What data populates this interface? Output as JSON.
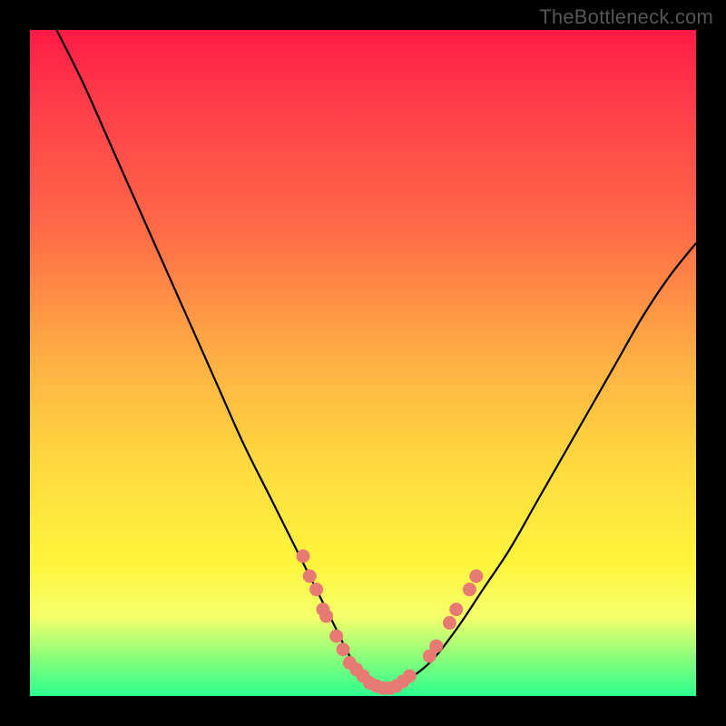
{
  "watermark": "TheBottleneck.com",
  "chart_data": {
    "type": "line",
    "title": "",
    "xlabel": "",
    "ylabel": "",
    "xlim": [
      0,
      100
    ],
    "ylim": [
      0,
      100
    ],
    "grid": false,
    "legend": false,
    "series": [
      {
        "name": "curve",
        "style": "black-line",
        "x": [
          4,
          8,
          12,
          16,
          20,
          24,
          28,
          32,
          36,
          40,
          44,
          46,
          48,
          50,
          52,
          54,
          56,
          60,
          64,
          68,
          72,
          76,
          80,
          84,
          88,
          92,
          96,
          100
        ],
        "y": [
          100,
          92,
          83,
          74,
          65,
          56,
          47,
          38,
          30,
          22,
          14,
          10,
          6,
          3,
          1,
          1,
          2,
          5,
          10,
          16,
          22,
          29,
          36,
          43,
          50,
          57,
          63,
          68
        ]
      },
      {
        "name": "markers-left",
        "style": "salmon-dot",
        "x": [
          41,
          42,
          43,
          44,
          44.5,
          46,
          47,
          48,
          49,
          50,
          51,
          52,
          53,
          54,
          55
        ],
        "y": [
          21,
          18,
          16,
          13,
          12,
          9,
          7,
          5,
          4,
          3,
          2,
          1.5,
          1.2,
          1.2,
          1.5
        ]
      },
      {
        "name": "markers-right",
        "style": "salmon-dot",
        "x": [
          56,
          57,
          60,
          61,
          63,
          64,
          66,
          67
        ],
        "y": [
          2.2,
          3,
          6,
          7.5,
          11,
          13,
          16,
          18
        ]
      }
    ],
    "annotations": []
  },
  "colors": {
    "marker": "#e87a74",
    "line": "#000000"
  }
}
